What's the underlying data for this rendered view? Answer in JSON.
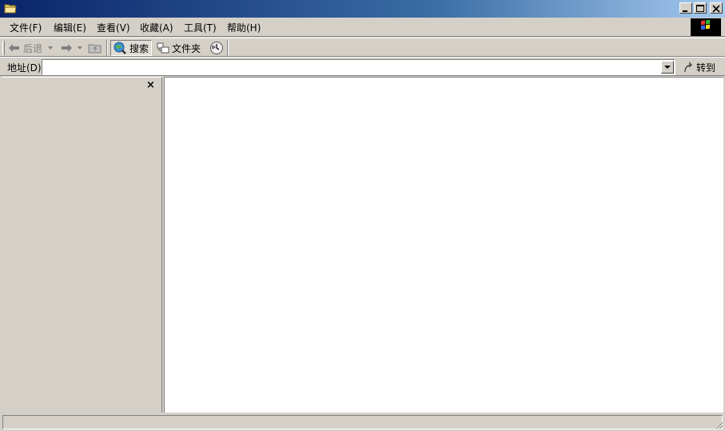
{
  "window": {
    "title": ""
  },
  "menu": {
    "file": "文件(F)",
    "edit": "编辑(E)",
    "view": "查看(V)",
    "favorites": "收藏(A)",
    "tools": "工具(T)",
    "help": "帮助(H)"
  },
  "toolbar": {
    "back": "后退",
    "search": "搜索",
    "folders": "文件夹"
  },
  "address": {
    "label": "地址(D)",
    "value": "",
    "go": "转到"
  },
  "sidepanel": {
    "close": "×"
  },
  "status": {
    "text": ""
  }
}
